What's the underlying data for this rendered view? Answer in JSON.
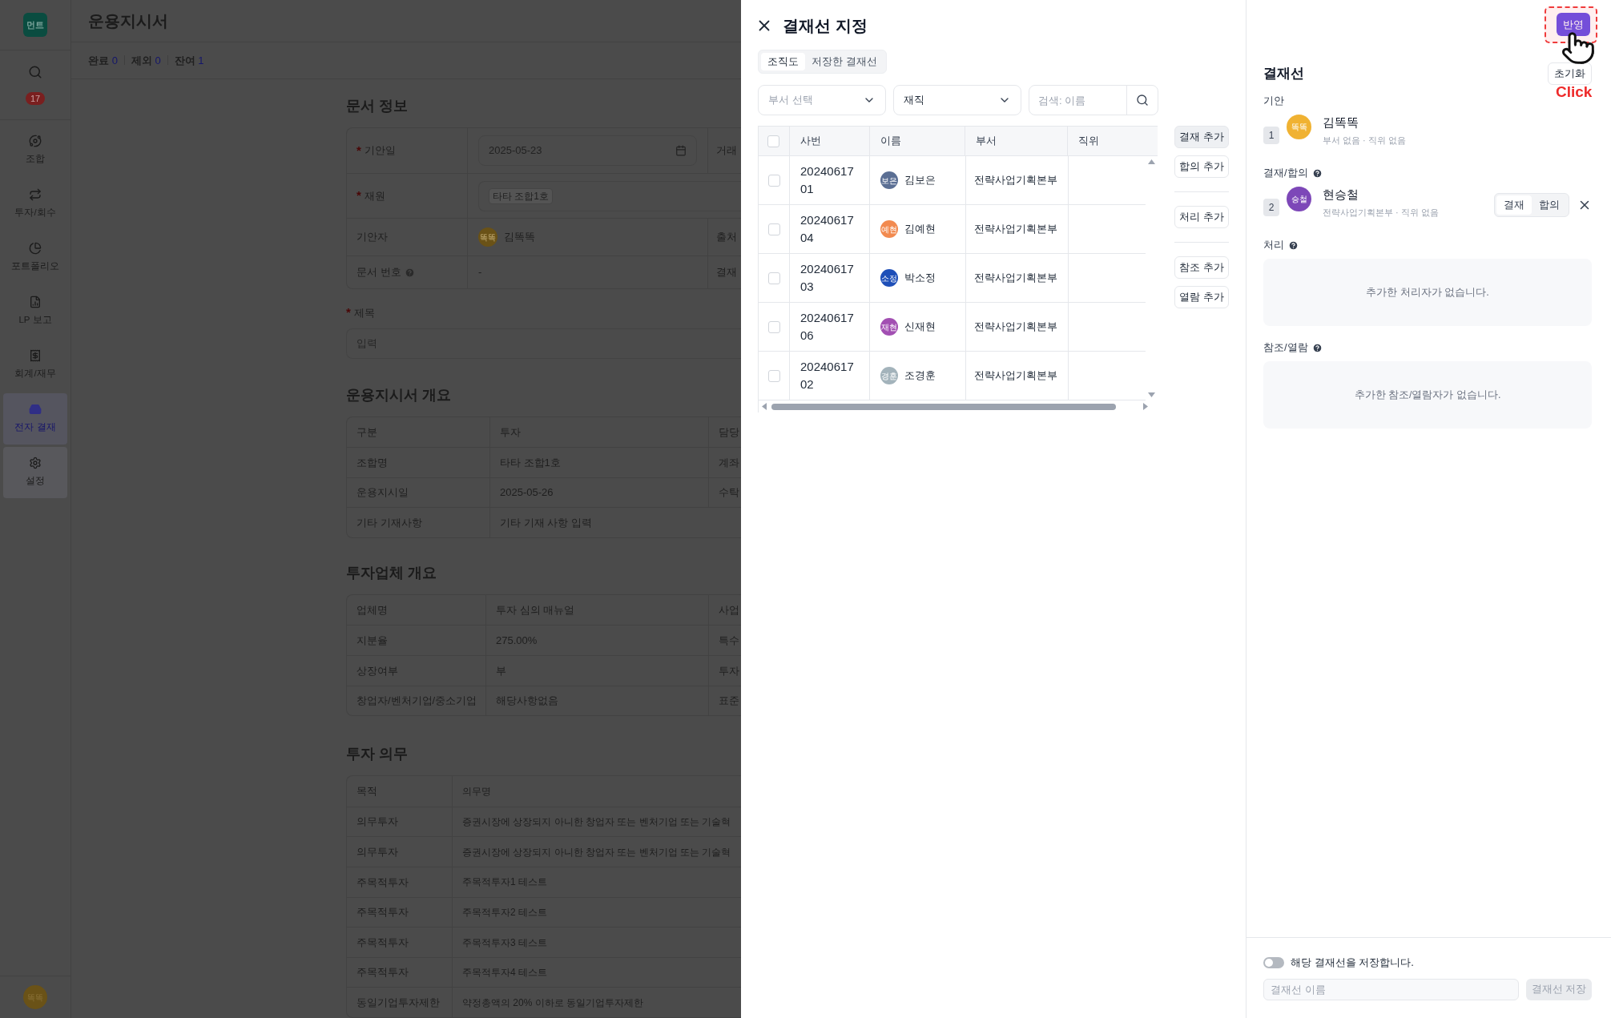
{
  "sidebar": {
    "logo": "먼트",
    "notification_count": "17",
    "items": [
      {
        "label": "조합",
        "selected": false,
        "hovered": false
      },
      {
        "label": "투자/회수",
        "selected": false,
        "hovered": false
      },
      {
        "label": "포트폴리오",
        "selected": false,
        "hovered": false
      },
      {
        "label": "LP 보고",
        "selected": false,
        "hovered": false
      },
      {
        "label": "회계/재무",
        "selected": false,
        "hovered": false
      },
      {
        "label": "전자 결재",
        "selected": true,
        "hovered": false
      },
      {
        "label": "설정",
        "selected": false,
        "hovered": true
      }
    ],
    "user_avatar": "똑똑"
  },
  "header": {
    "title": "운용지시서"
  },
  "status_counts": [
    {
      "label": "완료",
      "count": "0"
    },
    {
      "label": "제외",
      "count": "0"
    },
    {
      "label": "잔여",
      "count": "1"
    }
  ],
  "document_info": {
    "title": "문서 정보",
    "rows": [
      {
        "label": "기안일",
        "required_mark": "*",
        "help": false,
        "kind": "date",
        "value": "2025-05-23",
        "side_label": "거래"
      },
      {
        "label": "재원",
        "required_mark": "*",
        "help": false,
        "kind": "tag",
        "value": "타타 조합1호"
      },
      {
        "label": "기안자",
        "help": false,
        "kind": "user",
        "avatar": "똑똑",
        "value": "김똑똑",
        "side_label": "출처"
      },
      {
        "label": "문서 번호",
        "help": true,
        "kind": "text",
        "value": "-",
        "side_label": "결재"
      }
    ],
    "title_field": {
      "label": "제목",
      "required_mark": "*",
      "placeholder": "입력"
    }
  },
  "overview": {
    "title": "운용지시서 개요",
    "rows": [
      [
        "구분",
        "투자",
        "담당"
      ],
      [
        "조합명",
        "타타 조합1호",
        "계좌"
      ],
      [
        "운용지시일",
        "2025-05-26",
        "수탁"
      ],
      [
        "기타 기재사항",
        "기타 기재 사항 입력"
      ]
    ]
  },
  "company": {
    "title": "투자업체 개요",
    "rows": [
      [
        "업체명",
        "투자 심의 매뉴얼",
        "사업"
      ],
      [
        "지분율",
        "275.00%",
        "특수"
      ],
      [
        "상장여부",
        "부",
        "투자"
      ],
      [
        "창업자/벤처기업/중소기업",
        "해당사항없음",
        "표준"
      ]
    ]
  },
  "obligations": {
    "title": "투자 의무",
    "columns": [
      "목적",
      "의무명"
    ],
    "rows": [
      [
        "의무투자",
        "증권시장에 상장되지 아니한 창업자 또는 벤처기업 또는 기술혁"
      ],
      [
        "의무투자",
        "증권시장에 상장되지 아니한 창업자 또는 벤처기업 또는 기술혁"
      ],
      [
        "주목적투자",
        "주목적투자1 테스트"
      ],
      [
        "주목적투자",
        "주목적투자2 테스트"
      ],
      [
        "주목적투자",
        "주목적투자3 테스트"
      ],
      [
        "주목적투자",
        "주목적투자4 테스트"
      ],
      [
        "동일기업투자제한",
        "약정총액의 20% 이하로 동일기업투자제한"
      ]
    ]
  },
  "drawer": {
    "title": "결재선 지정",
    "tabs": [
      {
        "label": "조직도",
        "selected": true
      },
      {
        "label": "저장한 결재선",
        "selected": false
      }
    ],
    "department_select": {
      "placeholder": "부서 선택"
    },
    "status_select": {
      "value": "재직"
    },
    "search": {
      "placeholder": "검색: 이름"
    },
    "table": {
      "all_checked": false,
      "columns": [
        "사번",
        "이름",
        "부서",
        "직위"
      ],
      "rows": [
        {
          "checked": false,
          "employee_no": "2024061701",
          "avatar": "보은",
          "color": "#5b6f94",
          "name": "김보은",
          "department": "전략사업기획본부"
        },
        {
          "checked": false,
          "employee_no": "2024061704",
          "avatar": "예현",
          "color": "#f28a4f",
          "name": "김예현",
          "department": "전략사업기획본부"
        },
        {
          "checked": false,
          "employee_no": "2024061703",
          "avatar": "소정",
          "color": "#1e4fb8",
          "name": "박소정",
          "department": "전략사업기획본부"
        },
        {
          "checked": false,
          "employee_no": "2024061706",
          "avatar": "재현",
          "color": "#a24fb2",
          "name": "신재현",
          "department": "전략사업기획본부"
        },
        {
          "checked": false,
          "employee_no": "2024061702",
          "avatar": "경훈",
          "color": "#a3b3bb",
          "name": "조경훈",
          "department": "전략사업기획본부"
        }
      ]
    },
    "action_groups": [
      [
        {
          "label": "결재 추가",
          "hovered": true
        },
        {
          "label": "합의 추가",
          "hovered": false
        }
      ],
      [
        {
          "label": "처리 추가",
          "hovered": false
        }
      ],
      [
        {
          "label": "참조 추가",
          "hovered": false
        },
        {
          "label": "열람 추가",
          "hovered": false
        }
      ]
    ]
  },
  "approval_line": {
    "title": "결재선",
    "apply_button": "반영",
    "reset_button": "초기화",
    "annotation": "Click",
    "sections": [
      {
        "title": "기안",
        "help": false,
        "kind": "list",
        "entries": [
          {
            "order": "1",
            "avatar": "똑똑",
            "color": "#f0b232",
            "name": "김똑똑",
            "detail": "부서 없음 · 직위 없음",
            "removable": false
          }
        ]
      },
      {
        "title": "결재/합의",
        "help": true,
        "kind": "list",
        "entries": [
          {
            "order": "2",
            "avatar": "승철",
            "color": "#7d47b8",
            "name": "현승철",
            "detail": "전략사업기획본부 · 직위 없음",
            "removable": true,
            "types": [
              {
                "label": "결재",
                "selected": true
              },
              {
                "label": "합의",
                "selected": false
              }
            ]
          }
        ]
      },
      {
        "title": "처리",
        "help": true,
        "kind": "empty",
        "message": "추가한 처리자가 없습니다."
      },
      {
        "title": "참조/열람",
        "help": true,
        "kind": "empty",
        "message": "추가한 참조/열람자가 없습니다."
      }
    ],
    "save": {
      "toggle_label": "해당 결재선을 저장합니다.",
      "on": false,
      "name_placeholder": "결재선 이름",
      "save_button": "결재선 저장",
      "save_disabled": true
    }
  }
}
